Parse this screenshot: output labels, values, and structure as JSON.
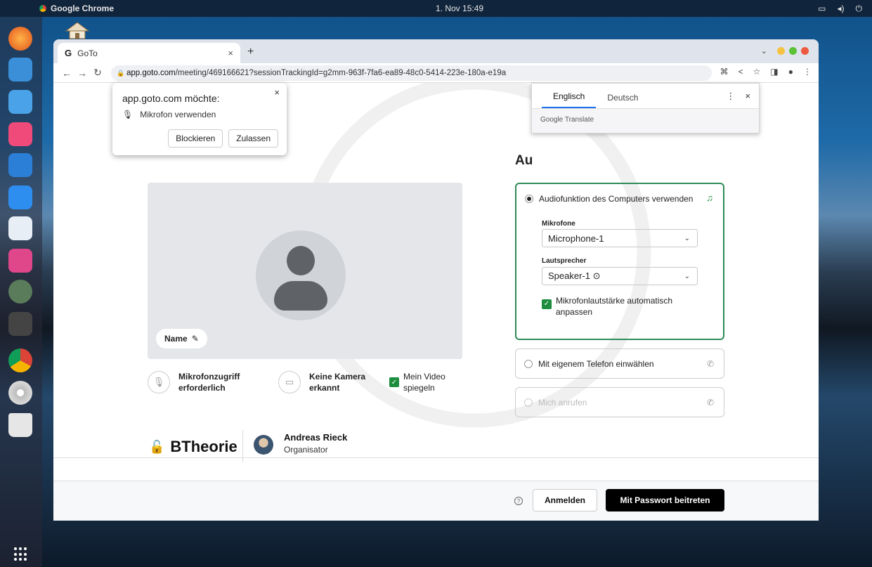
{
  "os": {
    "app_name": "Google Chrome",
    "clock": "1. Nov  15:49"
  },
  "browser": {
    "tab_title": "GoTo",
    "tab_icon": "G",
    "url_host": "app.goto.com",
    "url_path": "/meeting/469166621?sessionTrackingId=g2mm-963f-7fa6-ea89-48c0-5414-223e-180a-e19a"
  },
  "permission_popup": {
    "title": "app.goto.com möchte:",
    "item": "Mikrofon verwenden",
    "block": "Blockieren",
    "allow": "Zulassen"
  },
  "translate_popup": {
    "lang_from": "Englisch",
    "lang_to": "Deutsch",
    "brand": "Google Translate"
  },
  "preview": {
    "name_label": "Name"
  },
  "controls": {
    "mic_line1": "Mikrofonzugriff",
    "mic_line2": "erforderlich",
    "cam_line1": "Keine Kamera",
    "cam_line2": "erkannt",
    "mirror_line1": "Mein Video",
    "mirror_line2": "spiegeln"
  },
  "audio": {
    "title": "Au",
    "computer_option": "Audiofunktion des Computers verwenden",
    "mic_label": "Mikrofone",
    "mic_value": "Microphone-1",
    "speaker_label": "Lautsprecher",
    "speaker_value": "Speaker-1 ⊙",
    "agc_line1": "Mikrofonlautstärke automatisch",
    "agc_line2": "anpassen",
    "phone_option": "Mit eigenem Telefon einwählen",
    "callme_option": "Mich anrufen"
  },
  "meeting": {
    "name": "BTheorie",
    "organizer_name": "Andreas Rieck",
    "organizer_role": "Organisator"
  },
  "footer": {
    "signin": "Anmelden",
    "join": "Mit Passwort beitreten"
  },
  "colors": {
    "accent_green": "#2e8b57",
    "primary_button": "#000000"
  }
}
